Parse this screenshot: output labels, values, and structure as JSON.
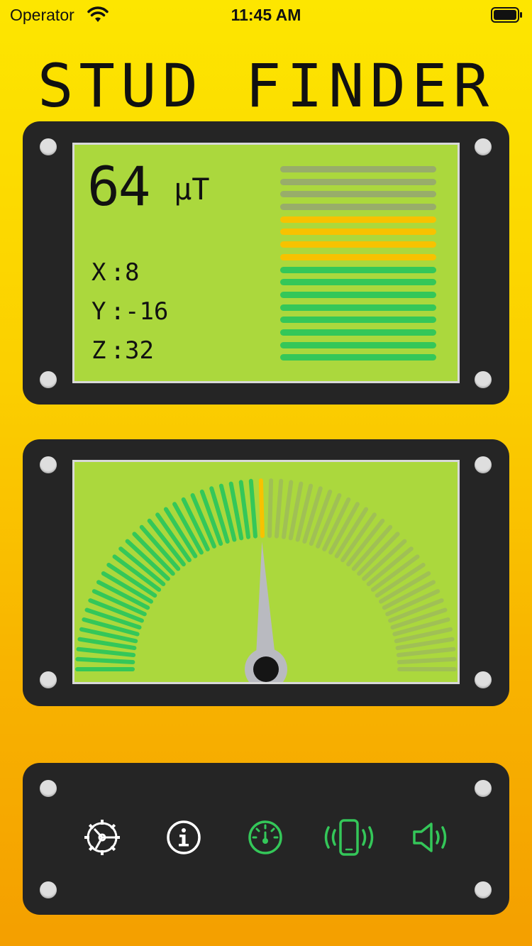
{
  "status_bar": {
    "carrier": "Operator",
    "time": "11:45 AM"
  },
  "title": "STUD FINDER",
  "readout": {
    "value": "64",
    "unit": "μT",
    "axes": [
      {
        "label": "X",
        "value": "8"
      },
      {
        "label": "Y",
        "value": "-16"
      },
      {
        "label": "Z",
        "value": "32"
      }
    ],
    "level_bars": {
      "total": 16,
      "colors_top_to_bottom": [
        "inactive",
        "inactive",
        "inactive",
        "inactive",
        "yellow",
        "yellow",
        "yellow",
        "yellow",
        "green",
        "green",
        "green",
        "green",
        "green",
        "green",
        "green",
        "green"
      ]
    }
  },
  "gauge": {
    "level_fraction": 0.49,
    "tick_count": 60
  },
  "controls": {
    "buttons": [
      {
        "icon": "settings-gear-icon"
      },
      {
        "icon": "info-icon"
      },
      {
        "icon": "gauge-icon"
      },
      {
        "icon": "vibration-icon"
      },
      {
        "icon": "speaker-icon"
      }
    ]
  },
  "colors": {
    "lcd": "#abd83d",
    "green": "#34c759",
    "yellow": "#f7c200",
    "inactive": "#98ad6a",
    "panel": "#252525",
    "needle": "#b9bac0"
  }
}
